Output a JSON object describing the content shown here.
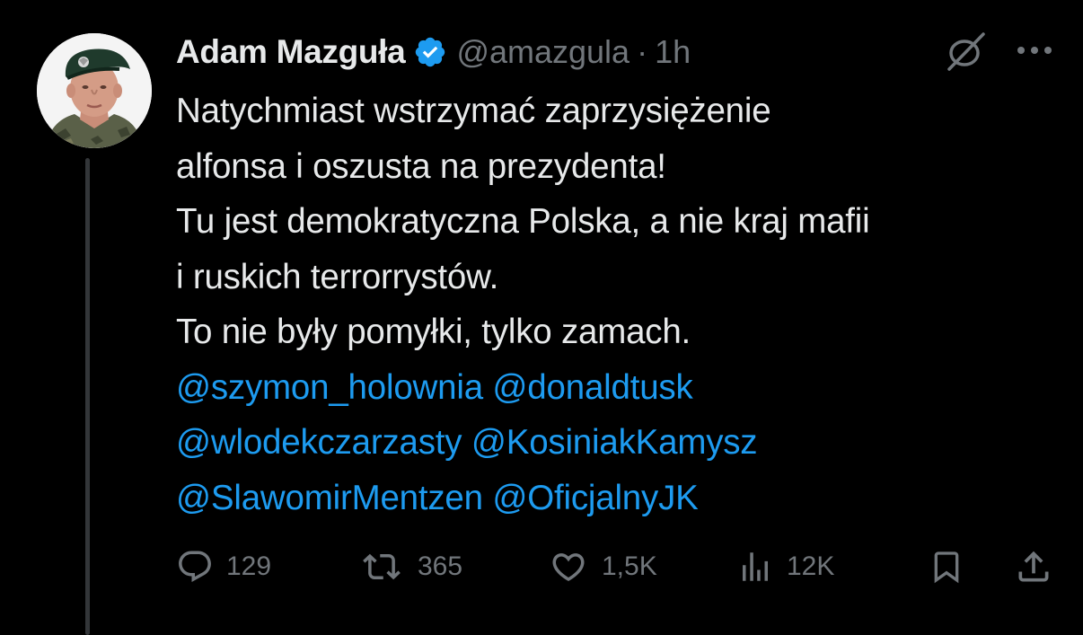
{
  "author": {
    "name": "Adam Mazguła",
    "handle": "@amazgula",
    "separator": "·",
    "time": "1h"
  },
  "tweet": {
    "lines": [
      "Natychmiast wstrzymać zaprzysiężenie",
      "alfonsa i oszusta na prezydenta!",
      "Tu jest demokratyczna Polska, a nie kraj mafii",
      "i ruskich terrorrystów.",
      "To nie były pomyłki, tylko zamach."
    ],
    "mentions": [
      "@szymon_holownia",
      "@donaldtusk",
      "@wlodekczarzasty",
      "@KosiniakKamysz",
      "@SlawomirMentzen",
      "@OficjalnyJK"
    ]
  },
  "actions": {
    "replies": "129",
    "reposts": "365",
    "likes": "1,5K",
    "views": "12K"
  },
  "colors": {
    "background": "#000000",
    "text": "#e7e9ea",
    "secondary": "#71767b",
    "link": "#1d9bf0",
    "verified": "#1d9bf0",
    "thread_line": "#333639"
  },
  "icons": [
    "verified-badge-icon",
    "grok-icon",
    "more-icon",
    "reply-icon",
    "repost-icon",
    "like-icon",
    "views-icon",
    "bookmark-icon",
    "share-icon"
  ]
}
